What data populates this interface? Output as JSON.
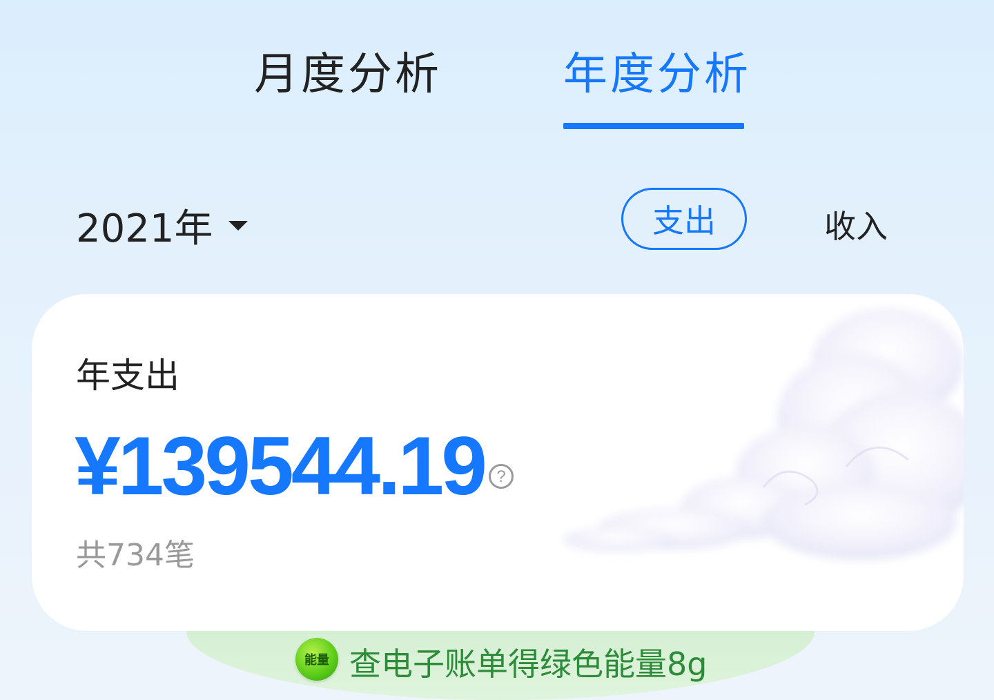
{
  "tabs": {
    "monthly": "月度分析",
    "yearly": "年度分析",
    "active": "yearly"
  },
  "filters": {
    "year": "2021年",
    "expense_label": "支出",
    "income_label": "收入",
    "selected": "expense"
  },
  "summary": {
    "title": "年支出",
    "amount": "¥139544.19",
    "count": "共734笔",
    "help_glyph": "?"
  },
  "banner": {
    "icon_text": "能量",
    "text": "查电子账单得绿色能量8g"
  },
  "colors": {
    "accent": "#1677ff",
    "energy_green": "#2e8b3a"
  }
}
